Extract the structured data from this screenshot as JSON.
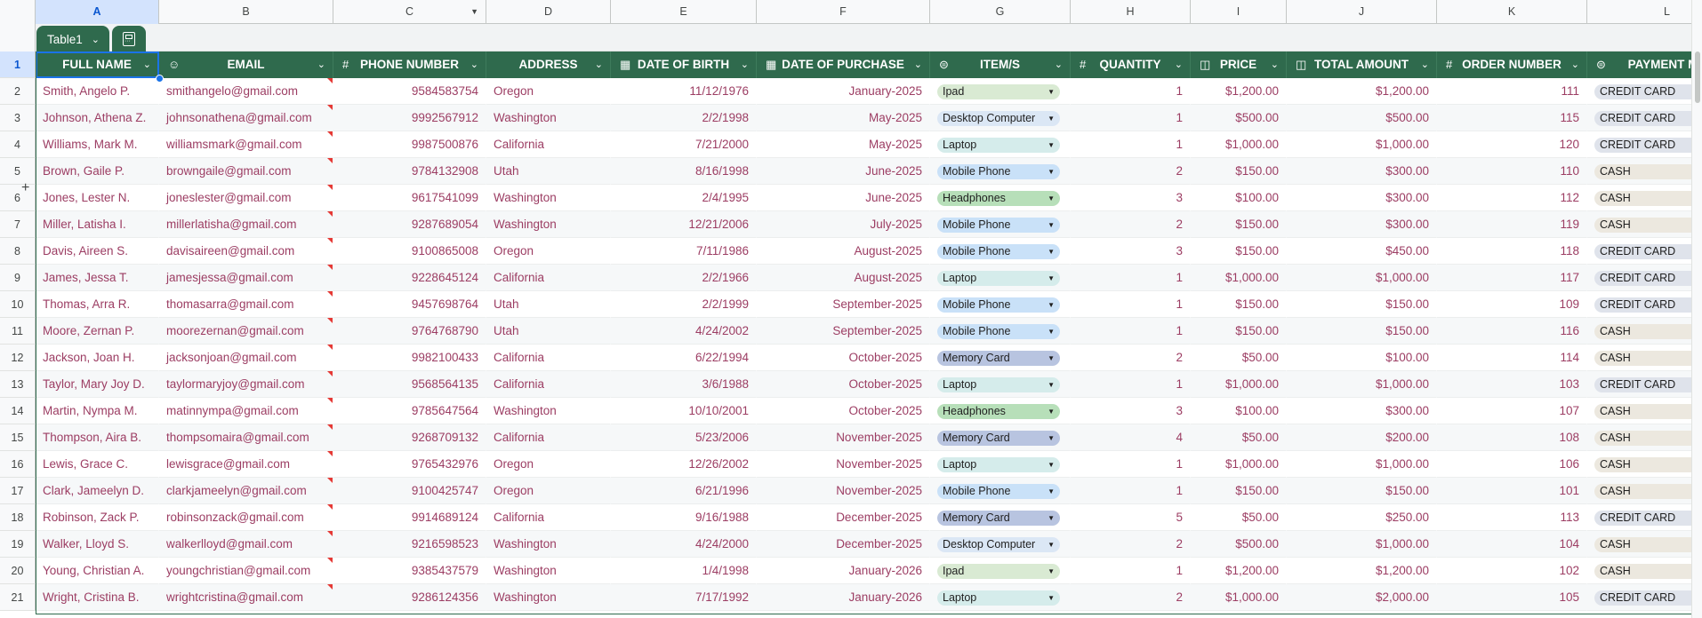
{
  "column_letters": [
    "A",
    "B",
    "C",
    "D",
    "E",
    "F",
    "G",
    "H",
    "I",
    "J",
    "K",
    "L"
  ],
  "table_name": "Table1",
  "header_row_number": "1",
  "headers": [
    {
      "label": "FULL NAME",
      "icon": ""
    },
    {
      "label": "EMAIL",
      "icon": "person-icon"
    },
    {
      "label": "PHONE NUMBER",
      "icon": "number-icon"
    },
    {
      "label": "ADDRESS",
      "icon": ""
    },
    {
      "label": "DATE OF BIRTH",
      "icon": "calendar-icon"
    },
    {
      "label": "DATE OF PURCHASE",
      "icon": "calendar-icon"
    },
    {
      "label": "ITEM/S",
      "icon": "dropdown-chip-icon"
    },
    {
      "label": "QUANTITY",
      "icon": "number-icon"
    },
    {
      "label": "PRICE",
      "icon": "currency-icon"
    },
    {
      "label": "TOTAL AMOUNT",
      "icon": "currency-icon"
    },
    {
      "label": "ORDER NUMBER",
      "icon": "number-icon"
    },
    {
      "label": "PAYMENT ME",
      "icon": "dropdown-chip-icon"
    }
  ],
  "item_colors": {
    "Ipad": "#d9ead3",
    "Desktop Computer": "#dbe7f5",
    "Laptop": "#d5eceb",
    "Mobile Phone": "#c9e1f8",
    "Headphones": "#b7dfb9",
    "Memory Card": "#b8c4e0"
  },
  "payment_colors": {
    "CREDIT CARD": "#dfe3eb",
    "CASH": "#ece8df"
  },
  "rows": [
    {
      "num": "2",
      "name": "Smith, Angelo P.",
      "email": "smithangelo@gmail.com",
      "phone": "9584583754",
      "address": "Oregon",
      "dob": "11/12/1976",
      "dop": "January-2025",
      "item": "Ipad",
      "qty": "1",
      "price": "$1,200.00",
      "total": "$1,200.00",
      "order": "111",
      "payment": "CREDIT CARD"
    },
    {
      "num": "3",
      "name": "Johnson, Athena Z.",
      "email": "johnsonathena@gmail.com",
      "phone": "9992567912",
      "address": "Washington",
      "dob": "2/2/1998",
      "dop": "May-2025",
      "item": "Desktop Computer",
      "qty": "1",
      "price": "$500.00",
      "total": "$500.00",
      "order": "115",
      "payment": "CREDIT CARD"
    },
    {
      "num": "4",
      "name": "Williams, Mark M.",
      "email": "williamsmark@gmail.com",
      "phone": "9987500876",
      "address": "California",
      "dob": "7/21/2000",
      "dop": "May-2025",
      "item": "Laptop",
      "qty": "1",
      "price": "$1,000.00",
      "total": "$1,000.00",
      "order": "120",
      "payment": "CREDIT CARD"
    },
    {
      "num": "5",
      "name": "Brown, Gaile P.",
      "email": "browngaile@gmail.com",
      "phone": "9784132908",
      "address": "Utah",
      "dob": "8/16/1998",
      "dop": "June-2025",
      "item": "Mobile Phone",
      "qty": "2",
      "price": "$150.00",
      "total": "$300.00",
      "order": "110",
      "payment": "CASH"
    },
    {
      "num": "6",
      "name": "Jones, Lester N.",
      "email": "joneslester@gmail.com",
      "phone": "9617541099",
      "address": "Washington",
      "dob": "2/4/1995",
      "dop": "June-2025",
      "item": "Headphones",
      "qty": "3",
      "price": "$100.00",
      "total": "$300.00",
      "order": "112",
      "payment": "CASH"
    },
    {
      "num": "7",
      "name": "Miller, Latisha I.",
      "email": "millerlatisha@gmail.com",
      "phone": "9287689054",
      "address": "Washington",
      "dob": "12/21/2006",
      "dop": "July-2025",
      "item": "Mobile Phone",
      "qty": "2",
      "price": "$150.00",
      "total": "$300.00",
      "order": "119",
      "payment": "CASH"
    },
    {
      "num": "8",
      "name": "Davis, Aireen S.",
      "email": "davisaireen@gmail.com",
      "phone": "9100865008",
      "address": "Oregon",
      "dob": "7/11/1986",
      "dop": "August-2025",
      "item": "Mobile Phone",
      "qty": "3",
      "price": "$150.00",
      "total": "$450.00",
      "order": "118",
      "payment": "CREDIT CARD"
    },
    {
      "num": "9",
      "name": "James, Jessa T.",
      "email": "jamesjessa@gmail.com",
      "phone": "9228645124",
      "address": "California",
      "dob": "2/2/1966",
      "dop": "August-2025",
      "item": "Laptop",
      "qty": "1",
      "price": "$1,000.00",
      "total": "$1,000.00",
      "order": "117",
      "payment": "CREDIT CARD"
    },
    {
      "num": "10",
      "name": "Thomas, Arra R.",
      "email": "thomasarra@gmail.com",
      "phone": "9457698764",
      "address": "Utah",
      "dob": "2/2/1999",
      "dop": "September-2025",
      "item": "Mobile Phone",
      "qty": "1",
      "price": "$150.00",
      "total": "$150.00",
      "order": "109",
      "payment": "CREDIT CARD"
    },
    {
      "num": "11",
      "name": "Moore, Zernan P.",
      "email": "moorezernan@gmail.com",
      "phone": "9764768790",
      "address": "Utah",
      "dob": "4/24/2002",
      "dop": "September-2025",
      "item": "Mobile Phone",
      "qty": "1",
      "price": "$150.00",
      "total": "$150.00",
      "order": "116",
      "payment": "CASH"
    },
    {
      "num": "12",
      "name": "Jackson, Joan H.",
      "email": "jacksonjoan@gmail.com",
      "phone": "9982100433",
      "address": "California",
      "dob": "6/22/1994",
      "dop": "October-2025",
      "item": "Memory Card",
      "qty": "2",
      "price": "$50.00",
      "total": "$100.00",
      "order": "114",
      "payment": "CASH"
    },
    {
      "num": "13",
      "name": "Taylor, Mary Joy D.",
      "email": "taylormaryjoy@gmail.com",
      "phone": "9568564135",
      "address": "California",
      "dob": "3/6/1988",
      "dop": "October-2025",
      "item": "Laptop",
      "qty": "1",
      "price": "$1,000.00",
      "total": "$1,000.00",
      "order": "103",
      "payment": "CREDIT CARD"
    },
    {
      "num": "14",
      "name": "Martin, Nympa M.",
      "email": "matinnympa@gmail.com",
      "phone": "9785647564",
      "address": "Washington",
      "dob": "10/10/2001",
      "dop": "October-2025",
      "item": "Headphones",
      "qty": "3",
      "price": "$100.00",
      "total": "$300.00",
      "order": "107",
      "payment": "CASH"
    },
    {
      "num": "15",
      "name": "Thompson, Aira B.",
      "email": "thompsomaira@gmail.com",
      "phone": "9268709132",
      "address": "California",
      "dob": "5/23/2006",
      "dop": "November-2025",
      "item": "Memory Card",
      "qty": "4",
      "price": "$50.00",
      "total": "$200.00",
      "order": "108",
      "payment": "CASH"
    },
    {
      "num": "16",
      "name": "Lewis, Grace C.",
      "email": "lewisgrace@gmail.com",
      "phone": "9765432976",
      "address": "Oregon",
      "dob": "12/26/2002",
      "dop": "November-2025",
      "item": "Laptop",
      "qty": "1",
      "price": "$1,000.00",
      "total": "$1,000.00",
      "order": "106",
      "payment": "CASH"
    },
    {
      "num": "17",
      "name": "Clark, Jameelyn D.",
      "email": "clarkjameelyn@gmail.com",
      "phone": "9100425747",
      "address": "Oregon",
      "dob": "6/21/1996",
      "dop": "November-2025",
      "item": "Mobile Phone",
      "qty": "1",
      "price": "$150.00",
      "total": "$150.00",
      "order": "101",
      "payment": "CASH"
    },
    {
      "num": "18",
      "name": "Robinson, Zack P.",
      "email": "robinsonzack@gmail.com",
      "phone": "9914689124",
      "address": "California",
      "dob": "9/16/1988",
      "dop": "December-2025",
      "item": "Memory Card",
      "qty": "5",
      "price": "$50.00",
      "total": "$250.00",
      "order": "113",
      "payment": "CREDIT CARD"
    },
    {
      "num": "19",
      "name": "Walker, Lloyd S.",
      "email": "walkerlloyd@gmail.com",
      "phone": "9216598523",
      "address": "Washington",
      "dob": "4/24/2000",
      "dop": "December-2025",
      "item": "Desktop Computer",
      "qty": "2",
      "price": "$500.00",
      "total": "$1,000.00",
      "order": "104",
      "payment": "CASH"
    },
    {
      "num": "20",
      "name": "Young, Christian A.",
      "email": "youngchristian@gmail.com",
      "phone": "9385437579",
      "address": "Washington",
      "dob": "1/4/1998",
      "dop": "January-2026",
      "item": "Ipad",
      "qty": "1",
      "price": "$1,200.00",
      "total": "$1,200.00",
      "order": "102",
      "payment": "CASH"
    },
    {
      "num": "21",
      "name": "Wright, Cristina B.",
      "email": "wrightcristina@gmail.com",
      "phone": "9286124356",
      "address": "Washington",
      "dob": "7/17/1992",
      "dop": "January-2026",
      "item": "Laptop",
      "qty": "2",
      "price": "$1,000.00",
      "total": "$2,000.00",
      "order": "105",
      "payment": "CREDIT CARD"
    }
  ]
}
